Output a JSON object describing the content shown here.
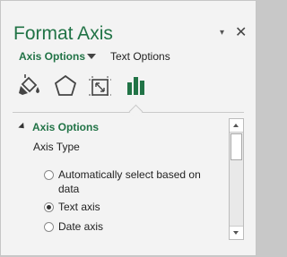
{
  "pane": {
    "title": "Format Axis",
    "pin_glyph": "▾",
    "close_glyph": "✕"
  },
  "subtabs": {
    "axis_options": "Axis Options",
    "text_options": "Text Options"
  },
  "icons": [
    {
      "name": "fill-line-icon"
    },
    {
      "name": "effects-icon"
    },
    {
      "name": "size-properties-icon"
    },
    {
      "name": "axis-options-icon",
      "selected": true
    }
  ],
  "section": {
    "header": "Axis Options",
    "axis_type_label": "Axis Type",
    "options": [
      {
        "label": "Automatically select based on data",
        "checked": false
      },
      {
        "label": "Text axis",
        "checked": true
      },
      {
        "label": "Date axis",
        "checked": false
      }
    ]
  },
  "colors": {
    "accent": "#217346"
  }
}
